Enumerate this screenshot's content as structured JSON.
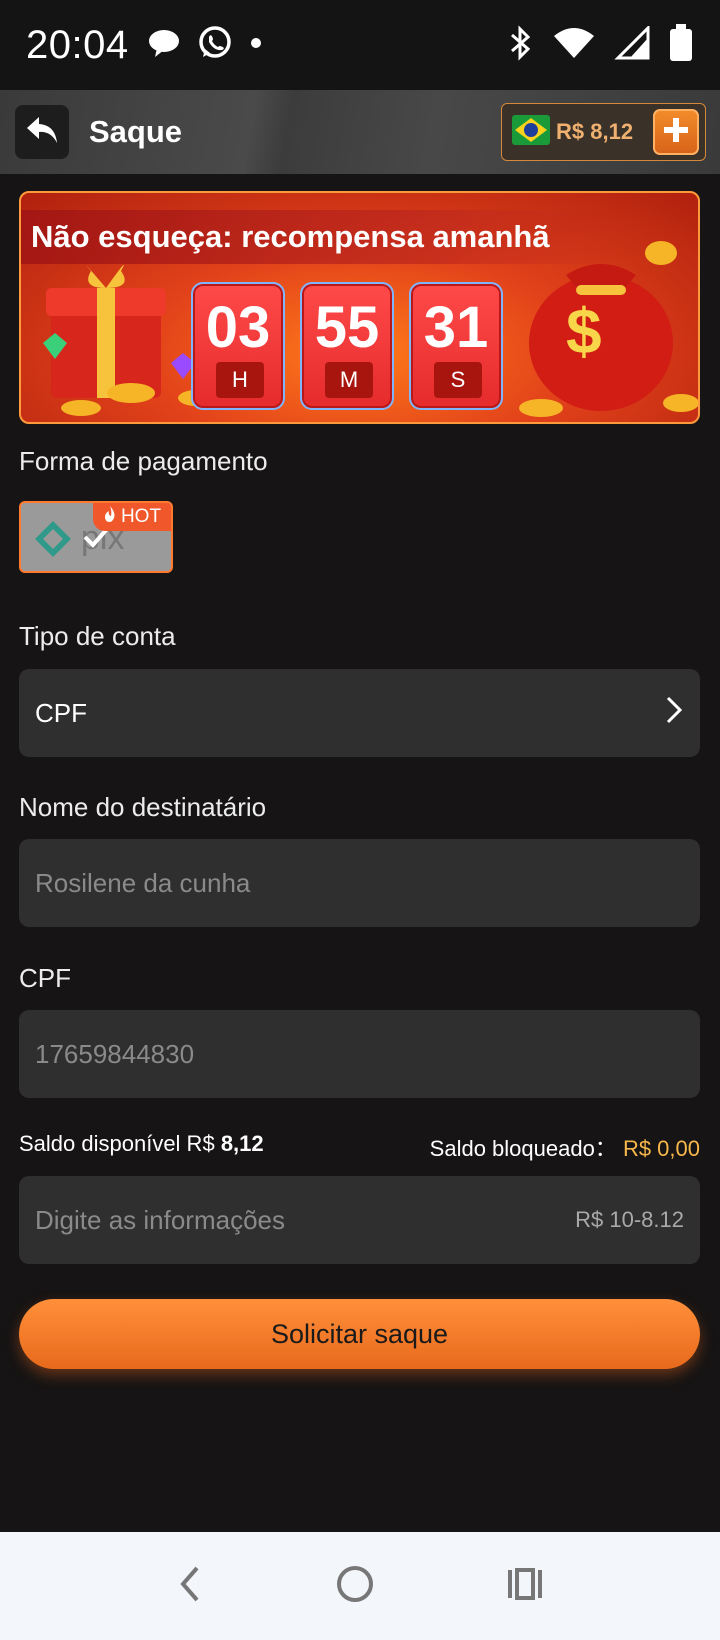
{
  "status_bar": {
    "time": "20:04",
    "left_icons": [
      "chat-bubble-icon",
      "whatsapp-icon",
      "dot-icon"
    ],
    "right_icons": [
      "bluetooth-icon",
      "wifi-icon",
      "signal-icon",
      "battery-icon"
    ]
  },
  "header": {
    "title": "Saque",
    "back_icon": "back-arrow-icon",
    "balance": "R$ 8,12",
    "flag_icon": "brazil-flag-icon",
    "add_icon": "plus-icon"
  },
  "banner": {
    "title": "Não esqueça: recompensa amanhã",
    "timer": [
      {
        "value": "03",
        "unit": "H"
      },
      {
        "value": "55",
        "unit": "M"
      },
      {
        "value": "31",
        "unit": "S"
      }
    ]
  },
  "payment": {
    "label": "Forma de pagamento",
    "method_name": "pix",
    "badge": "HOT"
  },
  "account_type": {
    "label": "Tipo de conta",
    "value": "CPF"
  },
  "recipient": {
    "label": "Nome do destinatário",
    "value": "Rosilene da cunha"
  },
  "cpf": {
    "label": "CPF",
    "value": "17659844830"
  },
  "balances": {
    "available_label": "Saldo disponível R$",
    "available_amount": "8,12",
    "blocked_label": "Saldo bloqueado：",
    "blocked_amount": "R$ 0,00"
  },
  "amount_field": {
    "placeholder": "Digite as informações",
    "range_hint": "R$ 10-8.12"
  },
  "submit": {
    "label": "Solicitar saque"
  },
  "colors": {
    "accent": "#f27a2a",
    "background": "#161414",
    "field_bg": "#2f2f2f",
    "blocked_amount": "#f7b74a"
  }
}
